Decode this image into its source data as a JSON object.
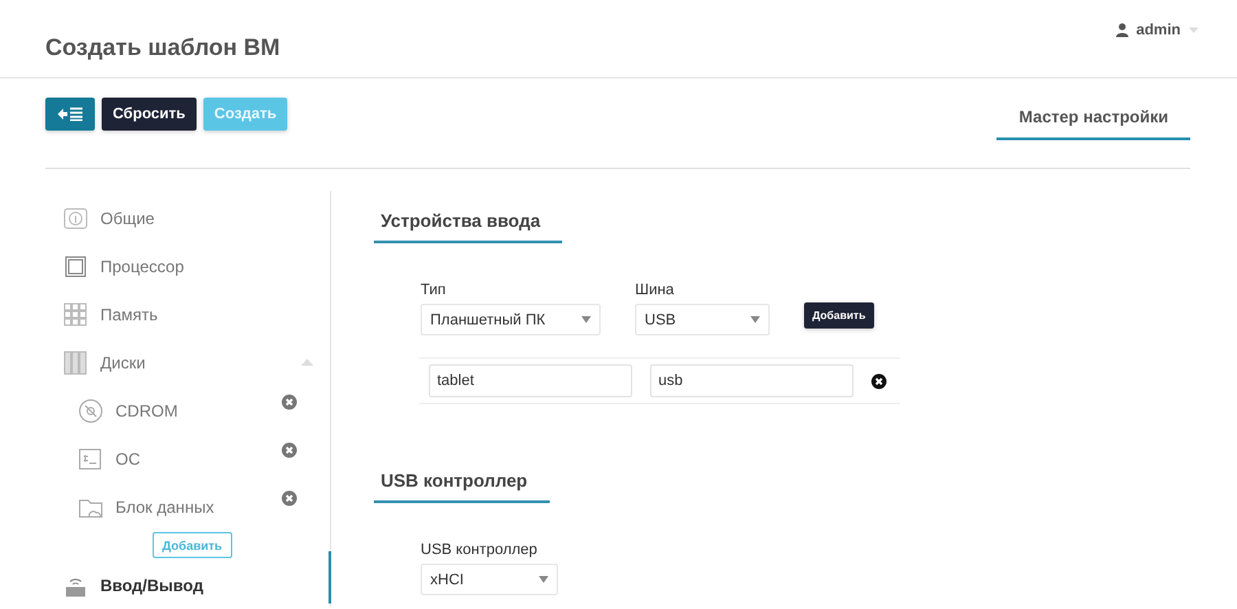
{
  "header": {
    "title": "Создать шаблон ВМ",
    "user": "admin"
  },
  "toolbar": {
    "buttons": [
      {
        "kind": "back"
      },
      {
        "kind": "reset",
        "label": "Сбросить"
      },
      {
        "kind": "create",
        "label": "Создать"
      }
    ]
  },
  "tabs": [
    {
      "label": "Мастер настройки",
      "selected": true
    }
  ],
  "sidebar": {
    "items": [
      {
        "label": "Общие",
        "selected": false
      },
      {
        "label": "Процессор",
        "selected": false
      },
      {
        "label": "Память",
        "selected": false
      },
      {
        "label": "Диски",
        "selected": false,
        "expanded": true,
        "children": [
          {
            "label": "CDROM"
          },
          {
            "label": "OC"
          },
          {
            "label": "Блок данных"
          }
        ],
        "add_button": "Добавить"
      },
      {
        "label": "Ввод/Вывод",
        "selected": true
      }
    ]
  },
  "sections": [
    {
      "kind": "input",
      "title": "Устройства ввода",
      "fields": [
        {
          "label": "Тип",
          "value": "Планшетный ПК"
        },
        {
          "label": "Шина",
          "value": "USB"
        }
      ],
      "add_button": "Добавить",
      "rows": [
        {
          "type": "tablet",
          "bus": "usb"
        }
      ]
    },
    {
      "kind": "usb",
      "title": "USB контроллер",
      "fields": [
        {
          "label": "USB контроллер",
          "value": "xHCI"
        }
      ]
    }
  ]
}
